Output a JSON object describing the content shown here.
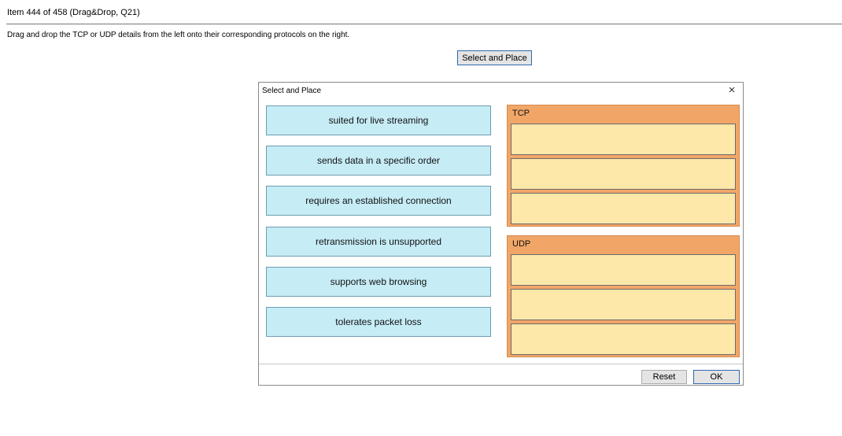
{
  "header": {
    "item_text": "Item 444 of 458  (Drag&Drop, Q21)",
    "instructions": "Drag and drop the TCP or UDP details from the left onto their corresponding protocols on the right."
  },
  "launch_button_label": "Select and Place",
  "dialog": {
    "title": "Select and Place",
    "close_symbol": "×",
    "items": [
      "suited for live streaming",
      "sends data in a specific order",
      "requires an established connection",
      "retransmission is unsupported",
      "supports web browsing",
      "tolerates packet loss"
    ],
    "groups": [
      {
        "label": "TCP",
        "slots": 3
      },
      {
        "label": "UDP",
        "slots": 3
      }
    ],
    "reset_label": "Reset",
    "ok_label": "OK"
  },
  "colors": {
    "item_fill": "#c6ecf6",
    "group_fill": "#f1a667",
    "slot_fill": "#fde7a9",
    "button_border": "#2d6ab0"
  }
}
